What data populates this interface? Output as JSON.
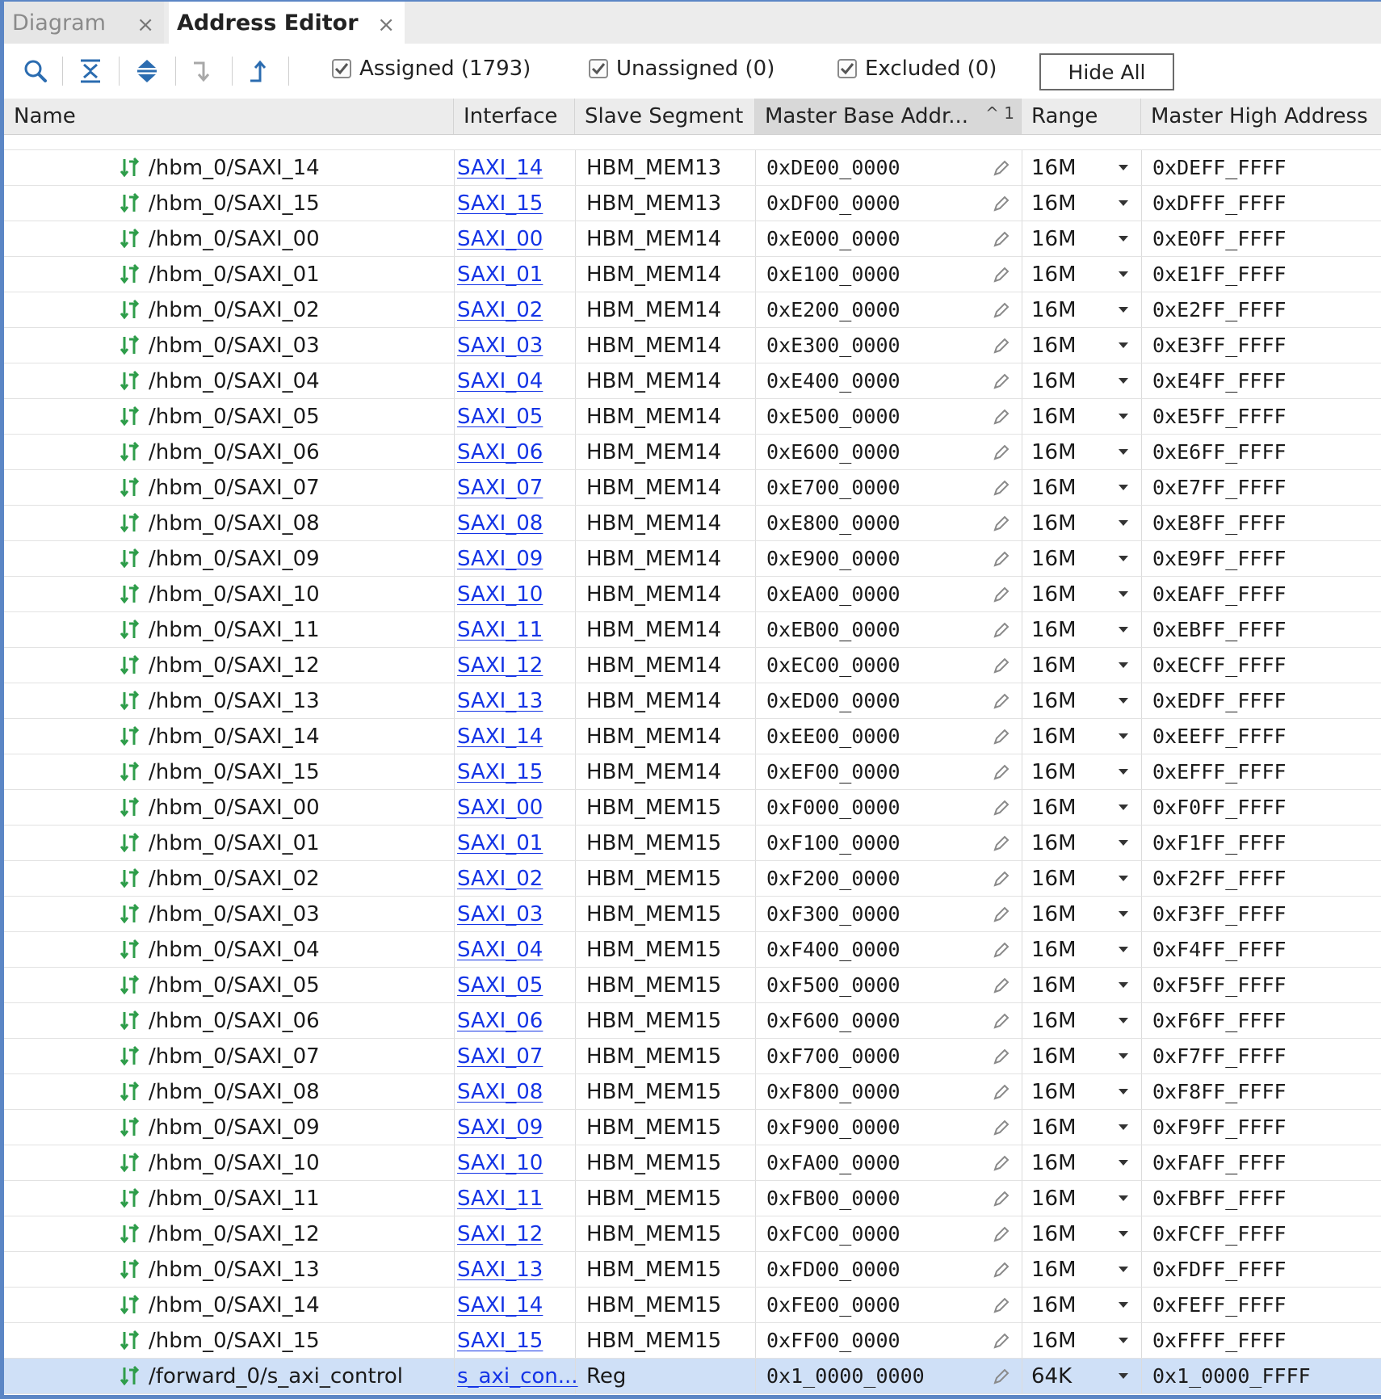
{
  "tabs": [
    {
      "label": "Diagram",
      "close": "×"
    },
    {
      "label": "Address Editor",
      "close": "×"
    }
  ],
  "toolbar": {
    "filters": [
      {
        "label": "Assigned (1793)",
        "checked": true
      },
      {
        "label": "Unassigned (0)",
        "checked": true
      },
      {
        "label": "Excluded (0)",
        "checked": true
      }
    ],
    "hide_all_label": "Hide All"
  },
  "columns": {
    "name": "Name",
    "interface": "Interface",
    "slave_segment": "Slave Segment",
    "master_base": "Master Base Addr...",
    "sort_indicator": "^ 1",
    "range": "Range",
    "master_high": "Master High Address"
  },
  "rows": [
    {
      "name": "/hbm_0/SAXI_14",
      "interface": "SAXI_14",
      "segment": "HBM_MEM13",
      "base": "0xDE00_0000",
      "range": "16M",
      "high": "0xDEFF_FFFF"
    },
    {
      "name": "/hbm_0/SAXI_15",
      "interface": "SAXI_15",
      "segment": "HBM_MEM13",
      "base": "0xDF00_0000",
      "range": "16M",
      "high": "0xDFFF_FFFF"
    },
    {
      "name": "/hbm_0/SAXI_00",
      "interface": "SAXI_00",
      "segment": "HBM_MEM14",
      "base": "0xE000_0000",
      "range": "16M",
      "high": "0xE0FF_FFFF"
    },
    {
      "name": "/hbm_0/SAXI_01",
      "interface": "SAXI_01",
      "segment": "HBM_MEM14",
      "base": "0xE100_0000",
      "range": "16M",
      "high": "0xE1FF_FFFF"
    },
    {
      "name": "/hbm_0/SAXI_02",
      "interface": "SAXI_02",
      "segment": "HBM_MEM14",
      "base": "0xE200_0000",
      "range": "16M",
      "high": "0xE2FF_FFFF"
    },
    {
      "name": "/hbm_0/SAXI_03",
      "interface": "SAXI_03",
      "segment": "HBM_MEM14",
      "base": "0xE300_0000",
      "range": "16M",
      "high": "0xE3FF_FFFF"
    },
    {
      "name": "/hbm_0/SAXI_04",
      "interface": "SAXI_04",
      "segment": "HBM_MEM14",
      "base": "0xE400_0000",
      "range": "16M",
      "high": "0xE4FF_FFFF"
    },
    {
      "name": "/hbm_0/SAXI_05",
      "interface": "SAXI_05",
      "segment": "HBM_MEM14",
      "base": "0xE500_0000",
      "range": "16M",
      "high": "0xE5FF_FFFF"
    },
    {
      "name": "/hbm_0/SAXI_06",
      "interface": "SAXI_06",
      "segment": "HBM_MEM14",
      "base": "0xE600_0000",
      "range": "16M",
      "high": "0xE6FF_FFFF"
    },
    {
      "name": "/hbm_0/SAXI_07",
      "interface": "SAXI_07",
      "segment": "HBM_MEM14",
      "base": "0xE700_0000",
      "range": "16M",
      "high": "0xE7FF_FFFF"
    },
    {
      "name": "/hbm_0/SAXI_08",
      "interface": "SAXI_08",
      "segment": "HBM_MEM14",
      "base": "0xE800_0000",
      "range": "16M",
      "high": "0xE8FF_FFFF"
    },
    {
      "name": "/hbm_0/SAXI_09",
      "interface": "SAXI_09",
      "segment": "HBM_MEM14",
      "base": "0xE900_0000",
      "range": "16M",
      "high": "0xE9FF_FFFF"
    },
    {
      "name": "/hbm_0/SAXI_10",
      "interface": "SAXI_10",
      "segment": "HBM_MEM14",
      "base": "0xEA00_0000",
      "range": "16M",
      "high": "0xEAFF_FFFF"
    },
    {
      "name": "/hbm_0/SAXI_11",
      "interface": "SAXI_11",
      "segment": "HBM_MEM14",
      "base": "0xEB00_0000",
      "range": "16M",
      "high": "0xEBFF_FFFF"
    },
    {
      "name": "/hbm_0/SAXI_12",
      "interface": "SAXI_12",
      "segment": "HBM_MEM14",
      "base": "0xEC00_0000",
      "range": "16M",
      "high": "0xECFF_FFFF"
    },
    {
      "name": "/hbm_0/SAXI_13",
      "interface": "SAXI_13",
      "segment": "HBM_MEM14",
      "base": "0xED00_0000",
      "range": "16M",
      "high": "0xEDFF_FFFF"
    },
    {
      "name": "/hbm_0/SAXI_14",
      "interface": "SAXI_14",
      "segment": "HBM_MEM14",
      "base": "0xEE00_0000",
      "range": "16M",
      "high": "0xEEFF_FFFF"
    },
    {
      "name": "/hbm_0/SAXI_15",
      "interface": "SAXI_15",
      "segment": "HBM_MEM14",
      "base": "0xEF00_0000",
      "range": "16M",
      "high": "0xEFFF_FFFF"
    },
    {
      "name": "/hbm_0/SAXI_00",
      "interface": "SAXI_00",
      "segment": "HBM_MEM15",
      "base": "0xF000_0000",
      "range": "16M",
      "high": "0xF0FF_FFFF"
    },
    {
      "name": "/hbm_0/SAXI_01",
      "interface": "SAXI_01",
      "segment": "HBM_MEM15",
      "base": "0xF100_0000",
      "range": "16M",
      "high": "0xF1FF_FFFF"
    },
    {
      "name": "/hbm_0/SAXI_02",
      "interface": "SAXI_02",
      "segment": "HBM_MEM15",
      "base": "0xF200_0000",
      "range": "16M",
      "high": "0xF2FF_FFFF"
    },
    {
      "name": "/hbm_0/SAXI_03",
      "interface": "SAXI_03",
      "segment": "HBM_MEM15",
      "base": "0xF300_0000",
      "range": "16M",
      "high": "0xF3FF_FFFF"
    },
    {
      "name": "/hbm_0/SAXI_04",
      "interface": "SAXI_04",
      "segment": "HBM_MEM15",
      "base": "0xF400_0000",
      "range": "16M",
      "high": "0xF4FF_FFFF"
    },
    {
      "name": "/hbm_0/SAXI_05",
      "interface": "SAXI_05",
      "segment": "HBM_MEM15",
      "base": "0xF500_0000",
      "range": "16M",
      "high": "0xF5FF_FFFF"
    },
    {
      "name": "/hbm_0/SAXI_06",
      "interface": "SAXI_06",
      "segment": "HBM_MEM15",
      "base": "0xF600_0000",
      "range": "16M",
      "high": "0xF6FF_FFFF"
    },
    {
      "name": "/hbm_0/SAXI_07",
      "interface": "SAXI_07",
      "segment": "HBM_MEM15",
      "base": "0xF700_0000",
      "range": "16M",
      "high": "0xF7FF_FFFF"
    },
    {
      "name": "/hbm_0/SAXI_08",
      "interface": "SAXI_08",
      "segment": "HBM_MEM15",
      "base": "0xF800_0000",
      "range": "16M",
      "high": "0xF8FF_FFFF"
    },
    {
      "name": "/hbm_0/SAXI_09",
      "interface": "SAXI_09",
      "segment": "HBM_MEM15",
      "base": "0xF900_0000",
      "range": "16M",
      "high": "0xF9FF_FFFF"
    },
    {
      "name": "/hbm_0/SAXI_10",
      "interface": "SAXI_10",
      "segment": "HBM_MEM15",
      "base": "0xFA00_0000",
      "range": "16M",
      "high": "0xFAFF_FFFF"
    },
    {
      "name": "/hbm_0/SAXI_11",
      "interface": "SAXI_11",
      "segment": "HBM_MEM15",
      "base": "0xFB00_0000",
      "range": "16M",
      "high": "0xFBFF_FFFF"
    },
    {
      "name": "/hbm_0/SAXI_12",
      "interface": "SAXI_12",
      "segment": "HBM_MEM15",
      "base": "0xFC00_0000",
      "range": "16M",
      "high": "0xFCFF_FFFF"
    },
    {
      "name": "/hbm_0/SAXI_13",
      "interface": "SAXI_13",
      "segment": "HBM_MEM15",
      "base": "0xFD00_0000",
      "range": "16M",
      "high": "0xFDFF_FFFF"
    },
    {
      "name": "/hbm_0/SAXI_14",
      "interface": "SAXI_14",
      "segment": "HBM_MEM15",
      "base": "0xFE00_0000",
      "range": "16M",
      "high": "0xFEFF_FFFF"
    },
    {
      "name": "/hbm_0/SAXI_15",
      "interface": "SAXI_15",
      "segment": "HBM_MEM15",
      "base": "0xFF00_0000",
      "range": "16M",
      "high": "0xFFFF_FFFF"
    },
    {
      "name": "/forward_0/s_axi_control",
      "interface": "s_axi_con...",
      "segment": "Reg",
      "base": "0x1_0000_0000",
      "range": "64K",
      "high": "0x1_0000_FFFF",
      "selected": true
    }
  ],
  "colors": {
    "selection": "#cfe0f7",
    "link": "#1434e6",
    "frame_border": "#5b86c5",
    "icon_green": "#2e9d4a"
  },
  "icons": {
    "search": "search-icon",
    "collapse_all": "collapse-all-icon",
    "expand_all": "expand-all-icon",
    "move_down": "move-down-icon",
    "move_up": "move-up-icon",
    "row_icon": "interface-icon",
    "edit": "pencil-icon",
    "dropdown": "dropdown-arrow-icon"
  }
}
